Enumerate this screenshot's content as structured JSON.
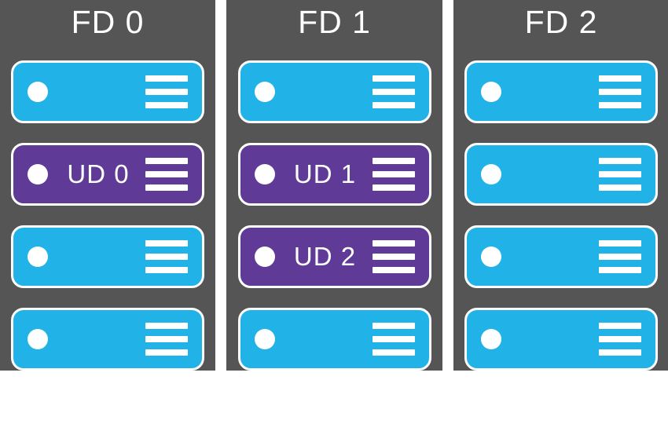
{
  "colors": {
    "blue": "#21b2e7",
    "purple": "#5f3b97",
    "panel": "#555555",
    "stroke": "#ffffff"
  },
  "fds": [
    {
      "id": "fd0",
      "title": "FD 0",
      "nodes": [
        {
          "id": "fd0-n0",
          "color": "blue",
          "label": ""
        },
        {
          "id": "fd0-n1",
          "color": "purple",
          "label": "UD 0"
        },
        {
          "id": "fd0-n2",
          "color": "blue",
          "label": ""
        },
        {
          "id": "fd0-n3",
          "color": "blue",
          "label": ""
        }
      ]
    },
    {
      "id": "fd1",
      "title": "FD 1",
      "nodes": [
        {
          "id": "fd1-n0",
          "color": "blue",
          "label": ""
        },
        {
          "id": "fd1-n1",
          "color": "purple",
          "label": "UD 1"
        },
        {
          "id": "fd1-n2",
          "color": "purple",
          "label": "UD 2"
        },
        {
          "id": "fd1-n3",
          "color": "blue",
          "label": ""
        }
      ]
    },
    {
      "id": "fd2",
      "title": "FD 2",
      "nodes": [
        {
          "id": "fd2-n0",
          "color": "blue",
          "label": ""
        },
        {
          "id": "fd2-n1",
          "color": "blue",
          "label": ""
        },
        {
          "id": "fd2-n2",
          "color": "blue",
          "label": ""
        },
        {
          "id": "fd2-n3",
          "color": "blue",
          "label": ""
        }
      ]
    }
  ]
}
